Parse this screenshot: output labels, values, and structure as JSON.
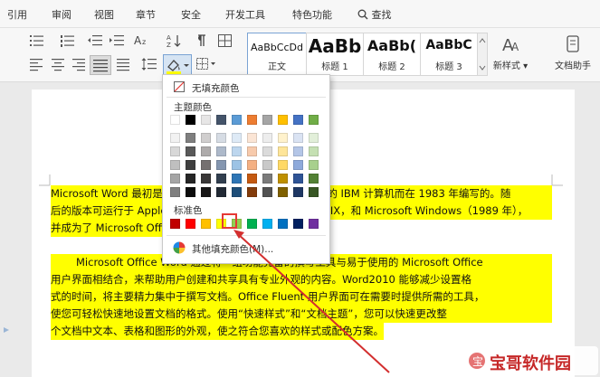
{
  "menu": {
    "items": [
      "引用",
      "审阅",
      "视图",
      "章节",
      "安全",
      "开发工具",
      "特色功能"
    ],
    "search_label": "查找"
  },
  "styles": {
    "items": [
      {
        "sample": "AaBbCcDd",
        "name": "正文"
      },
      {
        "sample": "AaBb",
        "name": "标题 1"
      },
      {
        "sample": "AaBb(",
        "name": "标题 2"
      },
      {
        "sample": "AaBbC",
        "name": "标题 3"
      }
    ],
    "new_style_label": "新样式",
    "doc_assistant_label": "文档助手"
  },
  "dropdown": {
    "no_fill_label": "无填充颜色",
    "theme_colors_label": "主题颜色",
    "standard_colors_label": "标准色",
    "more_colors_label": "其他填充颜色(M)...",
    "theme_row": [
      "#ffffff",
      "#000000",
      "#e7e6e6",
      "#44546a",
      "#5b9bd5",
      "#ed7d31",
      "#a5a5a5",
      "#ffc000",
      "#4472c4",
      "#70ad47"
    ],
    "theme_shades": [
      [
        "#f2f2f2",
        "#7f7f7f",
        "#d0cece",
        "#d6dce4",
        "#deeaf6",
        "#fbe5d5",
        "#ededed",
        "#fff2cc",
        "#dae3f3",
        "#e2efd9"
      ],
      [
        "#d8d8d8",
        "#595959",
        "#aeabab",
        "#adb9ca",
        "#bdd6ee",
        "#f7caac",
        "#dbdbdb",
        "#fee599",
        "#b4c6e7",
        "#c5e0b3"
      ],
      [
        "#bfbfbf",
        "#3f3f3f",
        "#757070",
        "#8496b0",
        "#9cc3e5",
        "#f4b083",
        "#c9c9c9",
        "#ffd965",
        "#8eaadb",
        "#a8d08d"
      ],
      [
        "#a5a5a5",
        "#262626",
        "#3a3838",
        "#323f4f",
        "#2e75b5",
        "#c45911",
        "#7b7b7b",
        "#bf9000",
        "#2f5496",
        "#538135"
      ],
      [
        "#7f7f7f",
        "#0c0c0c",
        "#171616",
        "#222a35",
        "#1e4e79",
        "#833c0b",
        "#525252",
        "#7f6000",
        "#1f3864",
        "#375623"
      ]
    ],
    "standard_row": [
      "#c00000",
      "#ff0000",
      "#ffc000",
      "#ffff00",
      "#92d050",
      "#00b050",
      "#00b0f0",
      "#0070c0",
      "#002060",
      "#7030a0"
    ]
  },
  "document": {
    "lines": [
      "Microsoft Word 最初是由 Richard Brodie 为了运行 DOS 的 IBM 计算机而在 1983 年编写的。随",
      "后的版本可运行于 Apple Macintosh（1984 年）、SCO UNIX，和 Microsoft Windows（1989 年），",
      "并成为了 Microsoft Office 的一部分。",
      "Microsoft Office Word 通过将一组功能完备的撰写工具与易于使用的 Microsoft Office",
      "用户界面相结合，来帮助用户创建和共享具有专业外观的内容。Word2010 能够减少设置格",
      "式的时间，将主要精力集中于撰写文档。Office Fluent 用户界面可在需要时提供所需的工具，",
      "使您可轻松快速地设置文档的格式。使用“快速样式”和“文档主题”，您可以快速更改整",
      "个文档中文本、表格和图形的外观，使之符合您喜欢的样式或配色方案。"
    ]
  },
  "watermark": {
    "text": "宝哥软件园"
  },
  "colors": {
    "highlight": "#ffff00",
    "selection_border": "#e53935",
    "arrow": "#d32f2f",
    "accent": "#2b5797"
  }
}
